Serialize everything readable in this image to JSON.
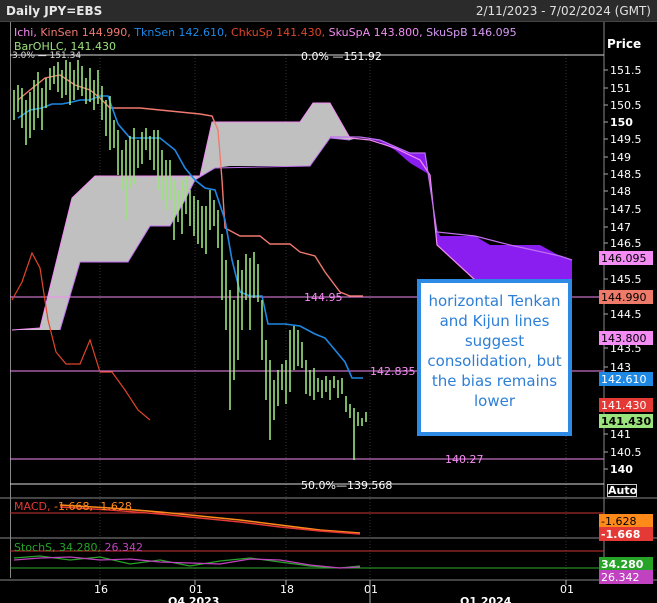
{
  "header": {
    "title": "Daily JPY=EBS",
    "date_range": "2/11/2023 - 7/02/2024 (GMT)"
  },
  "legend": {
    "ichi": "Ichi,",
    "kijun": "KinSen 144.990,",
    "tenkan": "TknSen 142.610,",
    "chikou": "ChkuSp 141.430,",
    "spanA": "SkuSpA 143.800,",
    "spanB": "SkuSpB 146.095",
    "bar": "BarOHLC, 141.430",
    "macd_name": "MACD,",
    "macd_vals": "-1.668, -1.628",
    "stoch_name": "StochS,",
    "stoch_k": "34.280,",
    "stoch_d": "26.342"
  },
  "price_axis": {
    "header": "Price",
    "ticks": [
      "151.5",
      "151",
      "150.5",
      "150",
      "149.5",
      "149",
      "148.5",
      "148",
      "147.5",
      "147",
      "146.5",
      "145.5",
      "145",
      "144.5",
      "143.5",
      "143",
      "141",
      "140.5",
      "140"
    ],
    "bold_ticks": [
      "150",
      "140"
    ]
  },
  "tags": {
    "spanB": {
      "text": "146.095",
      "bg": "#f58cf5",
      "fg": "#000"
    },
    "kijun": {
      "text": "144.990",
      "bg": "#ee7a6a",
      "fg": "#000"
    },
    "spanA": {
      "text": "143.800",
      "bg": "#f58cf5",
      "fg": "#000"
    },
    "tenkan": {
      "text": "142.610",
      "bg": "#1e88e5",
      "fg": "#fff"
    },
    "chikou": {
      "text": "141.430",
      "bg": "#e53935",
      "fg": "#fff"
    },
    "close": {
      "text": "141.430",
      "bg": "#9be37c",
      "fg": "#000"
    },
    "macd_signal": {
      "text": "-1.628",
      "bg": "#ff8a1a",
      "fg": "#000"
    },
    "macd": {
      "text": "-1.668",
      "bg": "#e53935",
      "fg": "#fff"
    },
    "stoch_k": {
      "text": "34.280",
      "bg": "#27a327",
      "fg": "#fff"
    },
    "stoch_d": {
      "text": "26.342",
      "bg": "#c042c0",
      "fg": "#fff"
    }
  },
  "chart_labels": {
    "fib_top": "0.0%",
    "fib_top_val": "151.92",
    "fib_top_left": "3.0%",
    "fib_top_left_val": "151.34",
    "fib_mid": "50.0%",
    "fib_mid_val": "139.568",
    "h_144": "144.95",
    "h_142": "142.835",
    "h_140": "140.27"
  },
  "x_axis": {
    "ticks": [
      "16",
      "01",
      "18",
      "01",
      "01"
    ],
    "periods": [
      "Q4 2023",
      "Q1 2024"
    ]
  },
  "note": "horizontal Tenkan and Kijun lines suggest consolidation, but the bias remains lower",
  "auto_label": "Auto",
  "colors": {
    "kijun": "#f07a70",
    "tenkan": "#1e88e5",
    "chikou": "#e0452a",
    "spanA": "#f58cf5",
    "spanB": "#c070f0",
    "cloud_bear": "#c0c0c0",
    "cloud_bull": "#8a1ef0",
    "bars": "#9be37c",
    "macd": "#e53935",
    "macd_signal": "#ff8a1a",
    "stoch_k": "#27a327",
    "stoch_d": "#c042c0"
  },
  "chart_data": {
    "type": "line",
    "title": "Daily JPY=EBS",
    "ylim": [
      139.6,
      152.2
    ],
    "x_days": 120,
    "ohlc_close": [
      150.9,
      150.7,
      150.5,
      150.2,
      150.4,
      150.6,
      150.9,
      151.2,
      151.4,
      151.6,
      151.5,
      151.3,
      150.9,
      150.7,
      150.4,
      150.5,
      150.3,
      150.1,
      150.0,
      149.9,
      149.6,
      149.4,
      149.7,
      149.5,
      149.5,
      149.8,
      149.5,
      149.3,
      149.1,
      149.4,
      148.9,
      148.6,
      148.4,
      148.2,
      147.8,
      147.6,
      147.3,
      147.1,
      146.8,
      146.6,
      146.4,
      146.9,
      146.6,
      146.3,
      145.8,
      145.3,
      144.7,
      144.2,
      143.8,
      144.5,
      144.9,
      144.6,
      143.4,
      142.7,
      142.2,
      142.8,
      143.6,
      143.2,
      142.4,
      142.1,
      141.9,
      142.4,
      142.0,
      141.7,
      142.1,
      142.3,
      142.1,
      141.6,
      141.3,
      141.1,
      140.8,
      140.6,
      141.2,
      141.4,
      141.4
    ],
    "kijun": [
      149.9,
      149.9,
      150.2,
      150.3,
      150.3,
      150.3,
      150.3,
      150.3,
      150.2,
      150.2,
      150.2,
      150.0,
      149.8,
      149.7,
      149.7,
      149.7,
      149.7,
      149.7,
      149.7,
      149.7,
      149.6,
      149.6,
      149.6,
      149.6,
      149.6,
      149.4,
      149.4,
      149.2,
      149.0,
      148.7,
      148.5,
      148.5,
      148.5,
      148.5,
      146.4,
      146.1,
      146.1,
      146.1,
      146.1,
      146.1,
      146.1,
      146.1,
      145.9,
      145.9,
      145.9,
      145.9,
      145.9,
      145.7,
      145.7,
      145.7,
      145.7,
      145.5,
      145.5,
      145.5,
      145.5,
      145.5,
      145.5,
      145.0,
      145.0,
      145.0
    ],
    "tenkan": [
      150.6,
      150.6,
      150.5,
      150.5,
      150.7,
      150.7,
      150.8,
      150.8,
      150.8,
      150.8,
      150.8,
      150.3,
      150.0,
      149.7,
      149.6,
      149.6,
      149.6,
      149.6,
      149.6,
      149.5,
      149.5,
      149.4,
      149.1,
      148.9,
      148.5,
      148.3,
      148.1,
      148.1,
      148.1,
      148.0,
      147.8,
      147.4,
      147.0,
      146.0,
      145.1,
      144.9,
      144.9,
      144.7,
      144.3,
      144.0,
      143.9,
      143.9,
      143.7,
      143.6,
      143.6,
      143.2,
      142.9,
      142.6,
      142.6,
      142.6
    ]
  }
}
